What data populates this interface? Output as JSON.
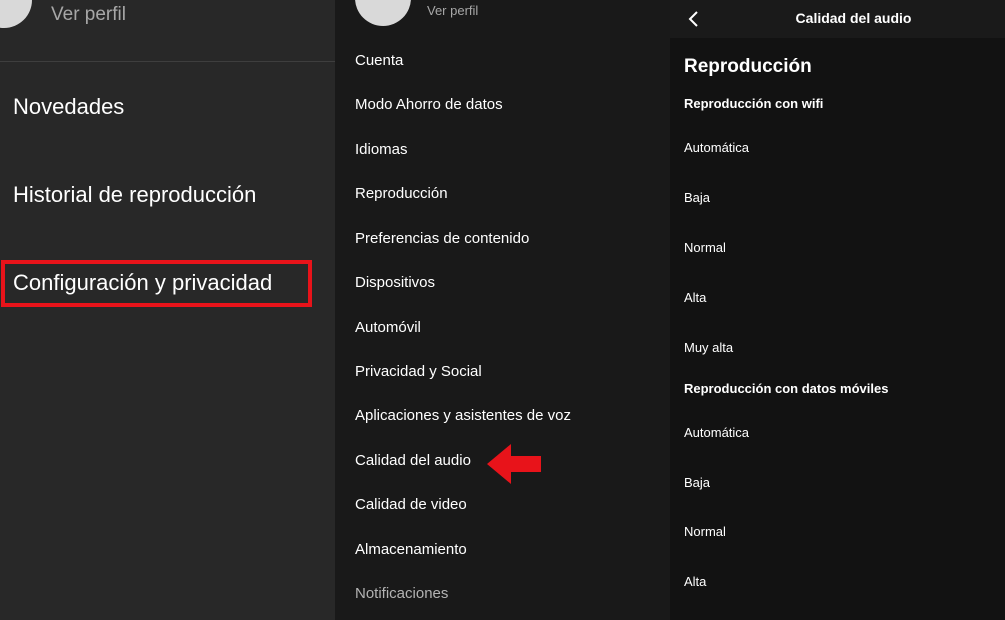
{
  "menu_panel": {
    "profile_link": "Ver perfil",
    "items": [
      "Novedades",
      "Historial de reproducción",
      "Configuración y privacidad"
    ]
  },
  "settings_panel": {
    "profile_link": "Ver perfil",
    "items": [
      "Cuenta",
      "Modo Ahorro de datos",
      "Idiomas",
      "Reproducción",
      "Preferencias de contenido",
      "Dispositivos",
      "Automóvil",
      "Privacidad y Social",
      "Aplicaciones y asistentes de voz",
      "Calidad del audio",
      "Calidad de video",
      "Almacenamiento",
      "Notificaciones"
    ]
  },
  "audio_panel": {
    "title": "Calidad del audio",
    "section": "Reproducción",
    "wifi_group": {
      "title": "Reproducción con wifi",
      "options": [
        "Automática",
        "Baja",
        "Normal",
        "Alta",
        "Muy alta"
      ]
    },
    "mobile_group": {
      "title": "Reproducción con datos móviles",
      "options": [
        "Automática",
        "Baja",
        "Normal",
        "Alta"
      ]
    }
  },
  "colors": {
    "highlight": "#e8131a",
    "arrow": "#e8131a"
  }
}
